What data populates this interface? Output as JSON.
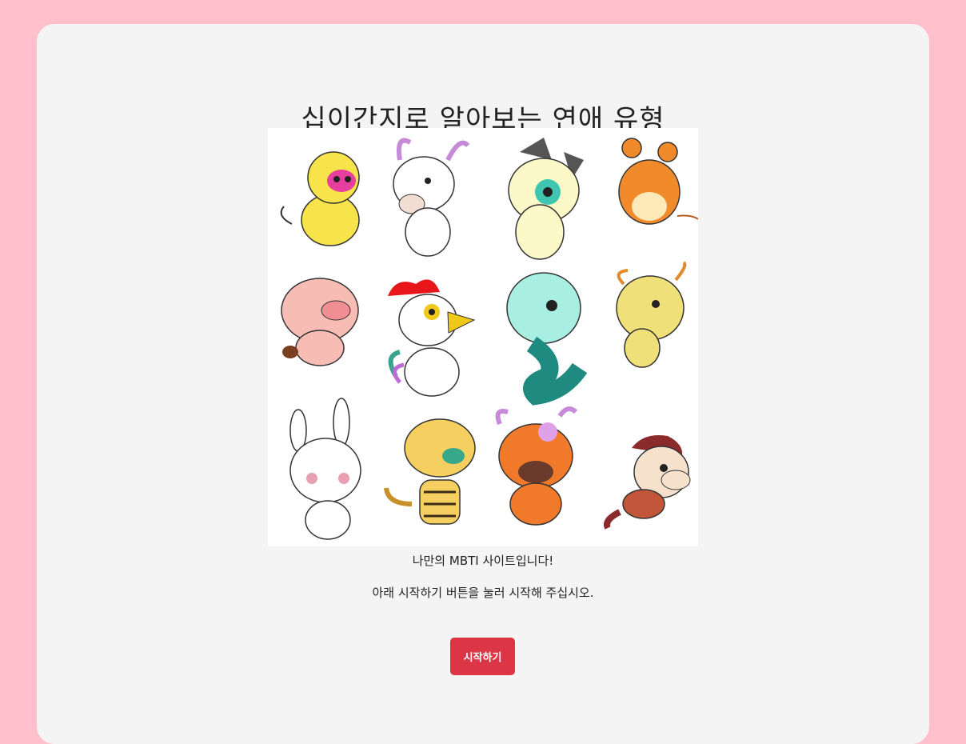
{
  "page": {
    "title": "십이간지로 알아보는 연애 유형",
    "intro": "나만의 MBTI 사이트입니다!",
    "guide": "아래 시작하기 버튼을 눌러 시작해 주십시오.",
    "start_label": "시작하기"
  },
  "colors": {
    "page_bg": "#ffc0cb",
    "card_bg": "#f4f4f4",
    "button": "#dc3545"
  },
  "hero": {
    "icons": [
      "monkey-icon",
      "goat-icon",
      "dog-icon",
      "rat-icon",
      "pig-icon",
      "rooster-icon",
      "snake-icon",
      "dragon-icon",
      "rabbit-icon",
      "tiger-icon",
      "ox-icon",
      "horse-icon"
    ]
  }
}
